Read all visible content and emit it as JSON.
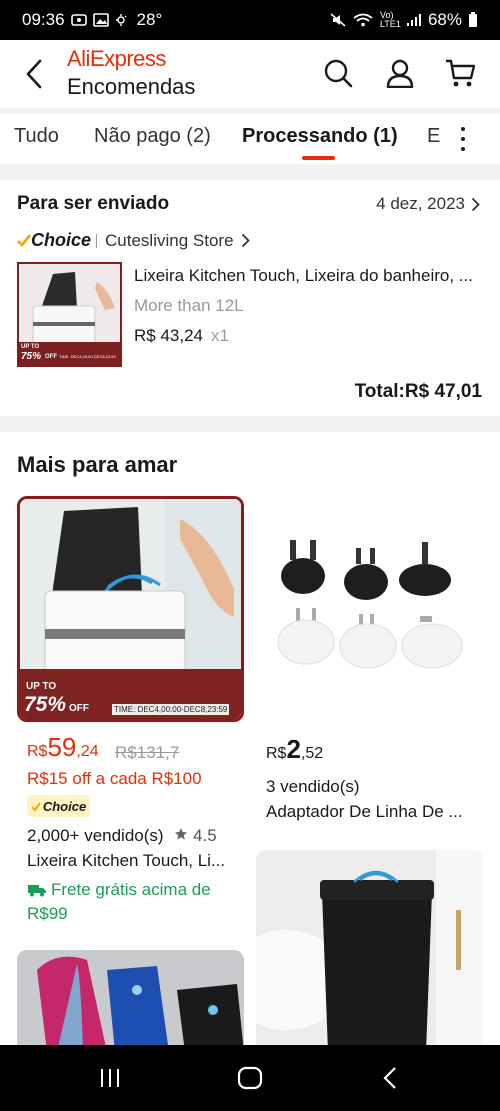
{
  "status_bar": {
    "time": "09:36",
    "temperature": "28°",
    "battery": "68%",
    "network": "Vo) LTE1"
  },
  "header": {
    "brand": "AliExpress",
    "title": "Encomendas",
    "icons": [
      "search-icon",
      "user-icon",
      "cart-icon"
    ]
  },
  "tabs": [
    {
      "label": "Tudo",
      "active": false
    },
    {
      "label": "Não pago (2)",
      "active": false
    },
    {
      "label": "Processando (1)",
      "active": true
    },
    {
      "label": "E",
      "active": false
    }
  ],
  "order": {
    "status": "Para ser enviado",
    "date": "4 dez, 2023",
    "choice_label": "Choice",
    "store": "Cutesliving Store",
    "product_title": "Lixeira Kitchen Touch, Lixeira do banheiro, ...",
    "variant": "More than 12L",
    "price": "R$ 43,24",
    "quantity": "x1",
    "total": "Total:R$ 47,01",
    "thumb_badge_top": "UP TO",
    "thumb_badge_pct": "75%",
    "thumb_badge_off": "OFF",
    "thumb_badge_time": "TIME: DEC4,00:00-DEC8,23:59"
  },
  "recommendations": {
    "title": "Mais para amar",
    "items": [
      {
        "badge_top": "UP TO",
        "badge_pct": "75%",
        "badge_off": "OFF",
        "badge_time": "TIME: DEC4,00:00-DEC8,23:59",
        "currency": "R$",
        "price_int": "59",
        "price_dec": ",24",
        "old_price": "R$131,7",
        "promo": "R$15 off a cada R$100",
        "choice_label": "Choice",
        "sold": "2,000+ vendido(s)",
        "rating": "4.5",
        "title": "Lixeira Kitchen Touch, Li...",
        "shipping": "Frete grátis acima de R$99"
      },
      {
        "currency": "R$",
        "price_int": "2",
        "price_dec": ",52",
        "sold": "3 vendido(s)",
        "title": "Adaptador De Linha De ..."
      }
    ]
  },
  "colors": {
    "accent": "#e62e04",
    "shipping_green": "#1a9e55",
    "choice_yellow": "#fff3c4"
  }
}
